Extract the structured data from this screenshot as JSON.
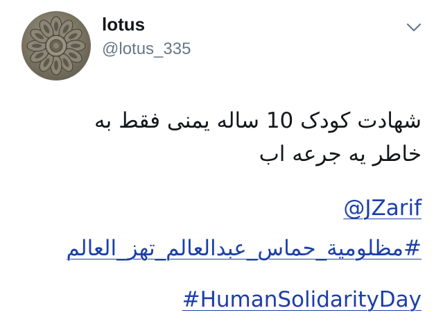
{
  "author": {
    "display_name": "lotus",
    "handle": "@lotus_335",
    "avatar_icon": "lotus-relief-avatar"
  },
  "menu": {
    "caret_icon": "chevron-down-icon"
  },
  "tweet": {
    "text_line_1": "شهادت  کودک 10 ساله یمنی فقط به",
    "text_line_2": "خاطر یه جرعه اب",
    "mention": "@JZarif",
    "hashtag_fa": "#مظلومية_حماس_عبدالعالم_تهز_العالم",
    "hashtag_en": "#HumanSolidarityDay"
  },
  "colors": {
    "link": "#1b3fa8",
    "handle": "#657786",
    "text": "#14171a"
  }
}
